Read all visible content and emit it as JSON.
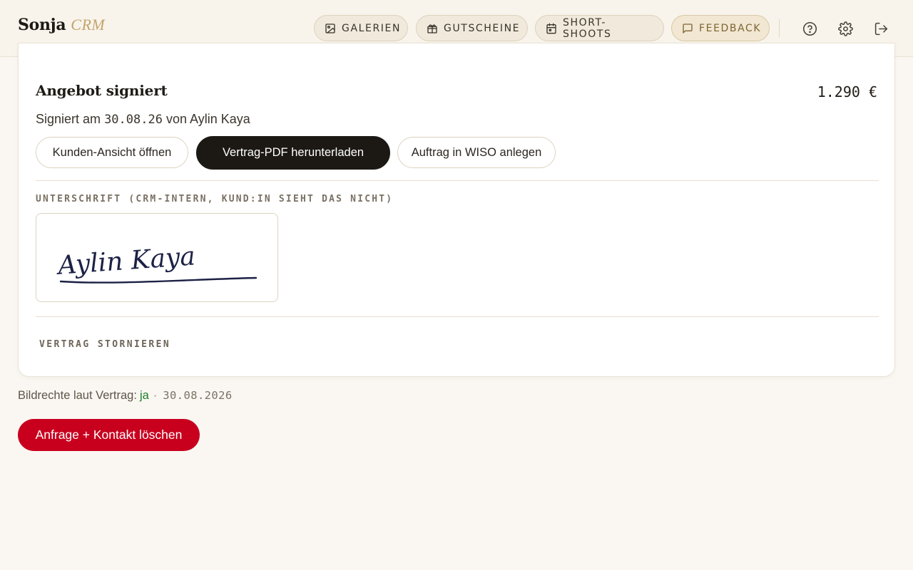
{
  "brand": {
    "name": "Sonja",
    "sub": "CRM"
  },
  "nav": {
    "galleries": "GALERIEN",
    "vouchers": "GUTSCHEINE",
    "short_shoots": "SHORT-SHOOTS",
    "feedback": "FEEDBACK"
  },
  "icons": {
    "help": "help-circle-icon",
    "settings": "gear-icon",
    "logout": "logout-icon"
  },
  "offer": {
    "title": "Angebot signiert",
    "amount": "1.290 €",
    "signed_prefix": "Signiert am",
    "signed_date": "30.08.26",
    "signed_by_prefix": "von",
    "signed_by": "Aylin Kaya",
    "btn_customer_view": "Kunden-Ansicht öffnen",
    "btn_download_pdf": "Vertrag-PDF herunterladen",
    "btn_wiso": "Auftrag in WISO anlegen",
    "signature_label": "UNTERSCHRIFT (CRM-INTERN, KUND:IN SIEHT DAS NICHT)",
    "signature_text": "Aylin Kaya",
    "cancel_contract": "VERTRAG STORNIEREN"
  },
  "rights": {
    "label": "Bildrechte laut Vertrag:",
    "value": "ja",
    "separator": "·",
    "date": "30.08.2026"
  },
  "delete_button": "Anfrage + Kontakt löschen",
  "colors": {
    "accent_gold": "#c4a36c",
    "danger": "#c8001e",
    "success": "#1b7f2a",
    "dark_button": "#1c1915",
    "signature_ink": "#1c2145"
  }
}
